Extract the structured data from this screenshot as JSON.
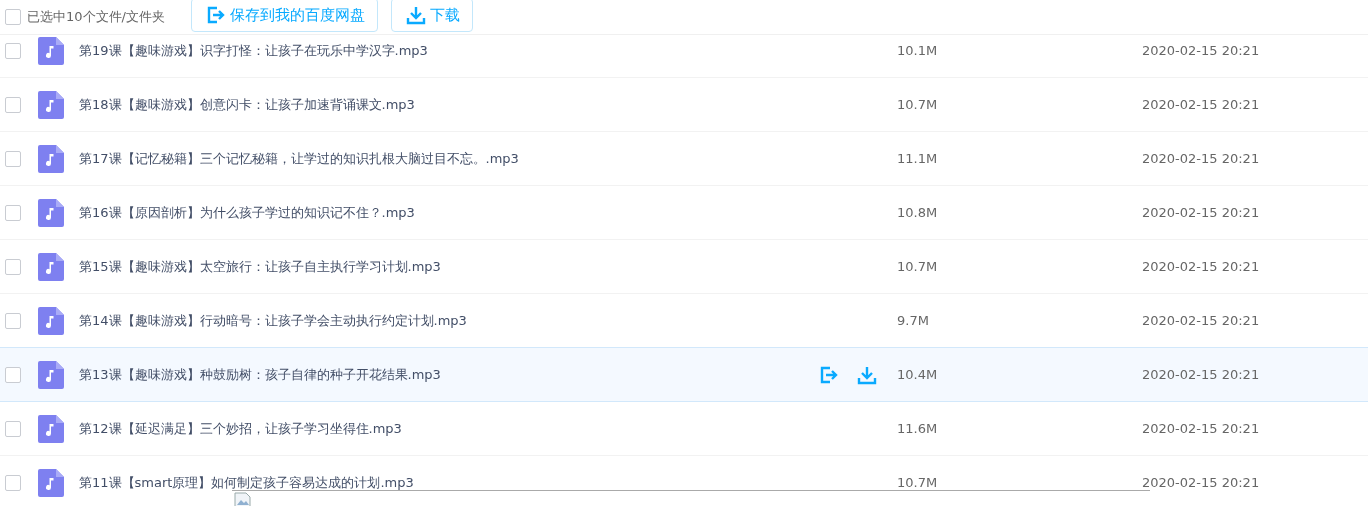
{
  "header": {
    "select_all": {
      "label": "已选中10个文件/文件夹",
      "checked": false
    },
    "buttons": [
      {
        "kind": "save",
        "label": "保存到我的百度网盘"
      },
      {
        "kind": "download",
        "label": "下载"
      }
    ]
  },
  "files": [
    {
      "name": "第19课【趣味游戏】识字打怪：让孩子在玩乐中学汉字.mp3",
      "size": "10.1M",
      "date": "2020-02-15 20:21",
      "checked": false,
      "hovered": false
    },
    {
      "name": "第18课【趣味游戏】创意闪卡：让孩子加速背诵课文.mp3",
      "size": "10.7M",
      "date": "2020-02-15 20:21",
      "checked": false,
      "hovered": false
    },
    {
      "name": "第17课【记忆秘籍】三个记忆秘籍，让学过的知识扎根大脑过目不忘。.mp3",
      "size": "11.1M",
      "date": "2020-02-15 20:21",
      "checked": false,
      "hovered": false
    },
    {
      "name": "第16课【原因剖析】为什么孩子学过的知识记不住？.mp3",
      "size": "10.8M",
      "date": "2020-02-15 20:21",
      "checked": false,
      "hovered": false
    },
    {
      "name": "第15课【趣味游戏】太空旅行：让孩子自主执行学习计划.mp3",
      "size": "10.7M",
      "date": "2020-02-15 20:21",
      "checked": false,
      "hovered": false
    },
    {
      "name": "第14课【趣味游戏】行动暗号：让孩子学会主动执行约定计划.mp3",
      "size": "9.7M",
      "date": "2020-02-15 20:21",
      "checked": false,
      "hovered": false
    },
    {
      "name": "第13课【趣味游戏】种鼓励树：孩子自律的种子开花结果.mp3",
      "size": "10.4M",
      "date": "2020-02-15 20:21",
      "checked": false,
      "hovered": true
    },
    {
      "name": "第12课【延迟满足】三个妙招，让孩子学习坐得住.mp3",
      "size": "11.6M",
      "date": "2020-02-15 20:21",
      "checked": false,
      "hovered": false
    },
    {
      "name": "第11课【smart原理】如何制定孩子容易达成的计划.mp3",
      "size": "10.7M",
      "date": "2020-02-15 20:21",
      "checked": false,
      "hovered": false
    }
  ]
}
